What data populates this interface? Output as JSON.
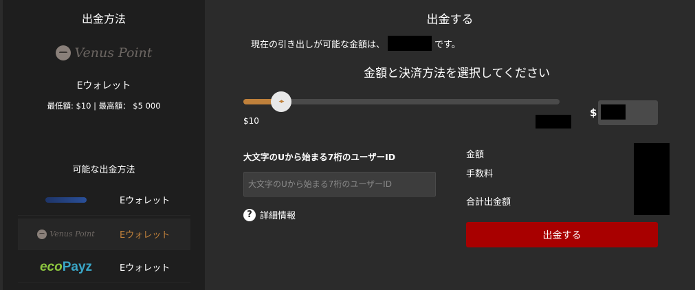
{
  "left_panel": {
    "title": "出金方法",
    "selected_logo_text": "Venus Point",
    "selected_method_name": "Eウォレット",
    "limits_text": "最低額: $10 | 最高額： $5 000",
    "available_methods_title": "可能な出金方法",
    "methods": [
      {
        "logo": "blue-brand-logo",
        "name": "Eウォレット"
      },
      {
        "logo_text": "Venus Point",
        "name": "Eウォレット"
      },
      {
        "logo_eco": "eco",
        "logo_payz": "Payz",
        "name": "Eウォレット"
      }
    ]
  },
  "main": {
    "title": "出金する",
    "balance_prefix": "現在の引き出しが可能な金額は、",
    "balance_suffix": "です。",
    "select_title": "金額と決済方法を選択してください",
    "slider": {
      "min_label": "$10",
      "handle_icon": "◂▸",
      "value_fraction": 0.12
    },
    "currency_symbol": "$",
    "user_id_label": "大文字のUから始まる7桁のユーザーID",
    "user_id_placeholder": "大文字のUから始まる7桁のユーザーID",
    "info_icon": "?",
    "info_label": "詳細情報",
    "summary": {
      "amount_label": "金額",
      "fee_label": "手数料",
      "total_label": "合計出金額"
    },
    "submit_label": "出金する"
  },
  "colors": {
    "accent": "#c0813b",
    "submit": "#a80000",
    "panel": "#1e1e1e",
    "background": "#2b2b2b"
  }
}
